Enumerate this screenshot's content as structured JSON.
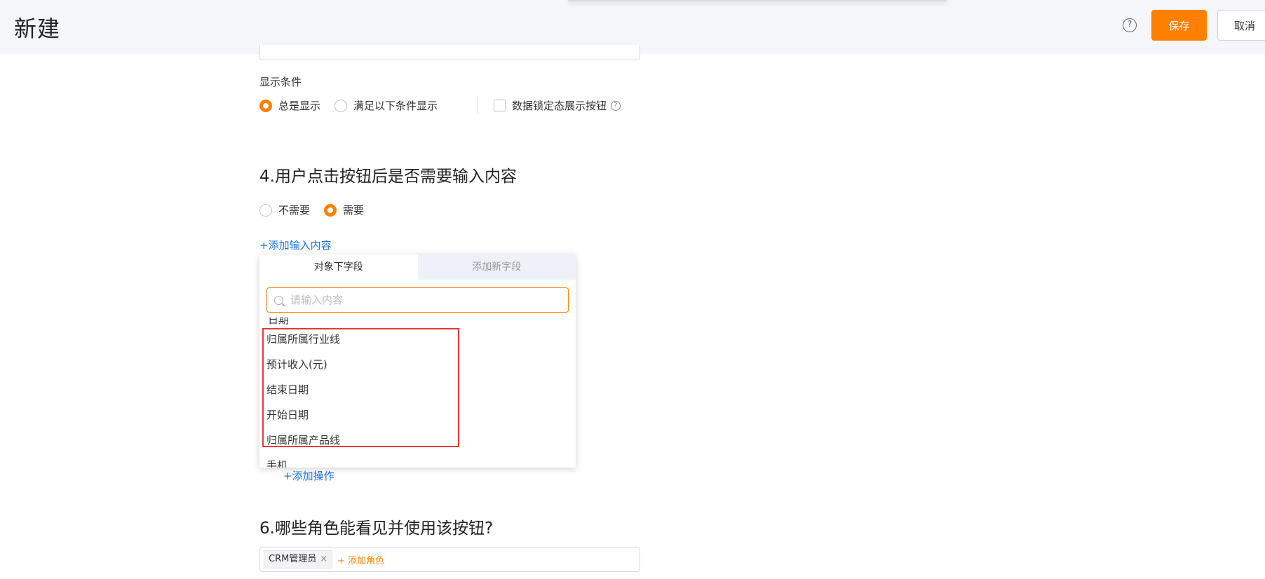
{
  "header": {
    "title": "新建",
    "help_icon": "?",
    "save_label": "保存",
    "cancel_label": "取消"
  },
  "display_condition": {
    "label": "显示条件",
    "options": [
      "总是显示",
      "满足以下条件显示"
    ],
    "selected": "总是显示",
    "lock_checkbox_label": "数据锁定态展示按钮",
    "lock_help_icon": "?"
  },
  "section4": {
    "title": "4.用户点击按钮后是否需要输入内容",
    "options": [
      "不需要",
      "需要"
    ],
    "selected": "需要",
    "add_input_link": "+添加输入内容"
  },
  "dropdown": {
    "tabs": [
      "对象下字段",
      "添加新字段"
    ],
    "active_tab": "对象下字段",
    "search_placeholder": "请输入内容",
    "cut_top_item": "日期",
    "items": [
      "归属所属行业线",
      "预计收入(元)",
      "结束日期",
      "开始日期",
      "归属所属产品线",
      "手机"
    ]
  },
  "section5": {
    "add_action_link": "+添加操作"
  },
  "section6": {
    "title": "6.哪些角色能看见并使用该按钮?",
    "tags": [
      "CRM管理员"
    ],
    "tag_remove_icon": "×",
    "add_role_link": "+ 添加角色"
  },
  "colors": {
    "accent": "#ff8000",
    "link": "#1a73e8",
    "highlight": "#e53935"
  }
}
